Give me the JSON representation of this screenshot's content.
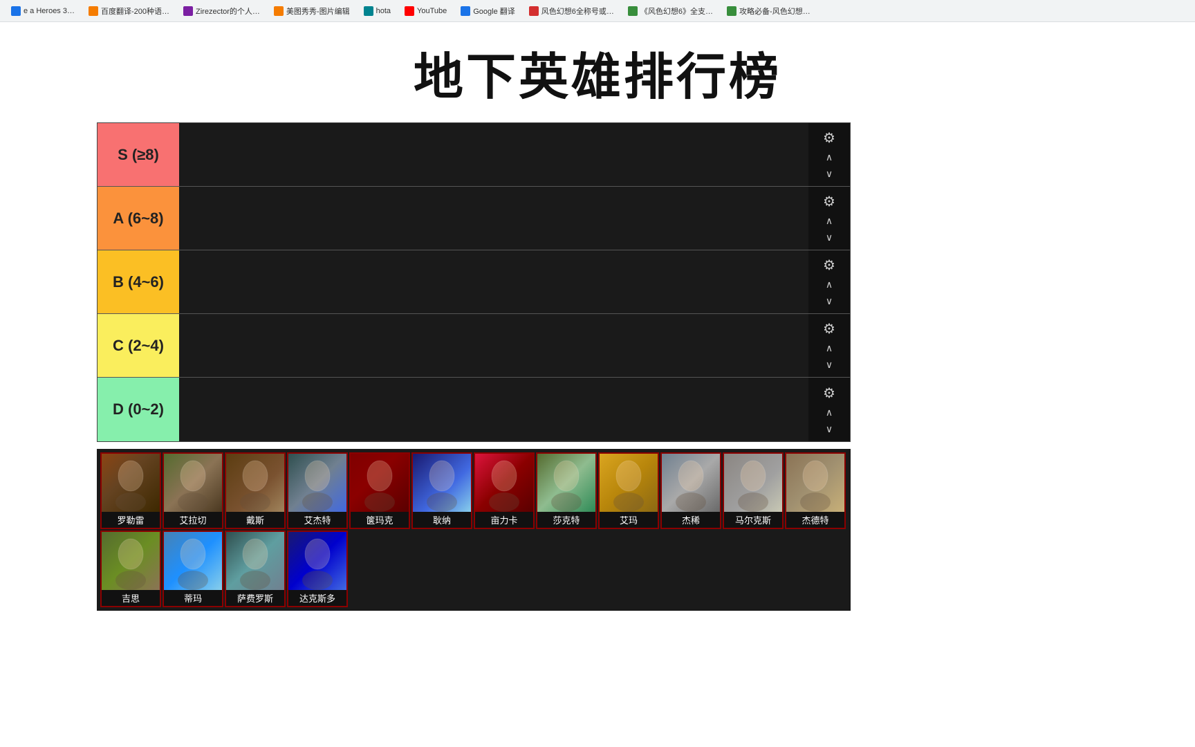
{
  "page": {
    "title": "地下英雄排行榜"
  },
  "bookmarks": [
    {
      "id": "bk1",
      "label": "e a Heroes 3…",
      "color": "bk-blue"
    },
    {
      "id": "bk2",
      "label": "百度翻译-200种语…",
      "color": "bk-orange"
    },
    {
      "id": "bk3",
      "label": "Zirezector的个人…",
      "color": "bk-purple"
    },
    {
      "id": "bk4",
      "label": "美图秀秀-图片编辑",
      "color": "bk-orange"
    },
    {
      "id": "bk5",
      "label": "hota",
      "color": "bk-teal"
    },
    {
      "id": "bk6",
      "label": "YouTube",
      "color": "bk-youtube"
    },
    {
      "id": "bk7",
      "label": "Google 翻译",
      "color": "bk-blue"
    },
    {
      "id": "bk8",
      "label": "风色幻想6全称号或…",
      "color": "bk-red"
    },
    {
      "id": "bk9",
      "label": "《风色幻想6》全支…",
      "color": "bk-green"
    },
    {
      "id": "bk10",
      "label": "攻略必备-风色幻想…",
      "color": "bk-green"
    }
  ],
  "tiers": [
    {
      "id": "s",
      "label": "S  (≥8)",
      "colorClass": "tier-s"
    },
    {
      "id": "a",
      "label": "A  (6~8)",
      "colorClass": "tier-a"
    },
    {
      "id": "b",
      "label": "B  (4~6)",
      "colorClass": "tier-b"
    },
    {
      "id": "c",
      "label": "C  (2~4)",
      "colorClass": "tier-c"
    },
    {
      "id": "d",
      "label": "D  (0~2)",
      "colorClass": "tier-d"
    }
  ],
  "heroes": [
    {
      "id": "luodun",
      "name": "罗勒雷",
      "portraitClass": "p-luodun",
      "row": 1
    },
    {
      "id": "ailaqi",
      "name": "艾拉切",
      "portraitClass": "p-ailaqi",
      "row": 1
    },
    {
      "id": "daisi",
      "name": "戴斯",
      "portraitClass": "p-daisi",
      "row": 1
    },
    {
      "id": "aijete",
      "name": "艾杰特",
      "portraitClass": "p-aijete",
      "row": 1
    },
    {
      "id": "jiemake",
      "name": "箧玛克",
      "portraitClass": "p-jiemake",
      "row": 1
    },
    {
      "id": "hengnuo",
      "name": "耿纳",
      "portraitClass": "p-hengnuo",
      "row": 1
    },
    {
      "id": "milika",
      "name": "亩力卡",
      "portraitClass": "p-milika",
      "row": 1
    },
    {
      "id": "shaokete",
      "name": "莎克特",
      "portraitClass": "p-shaokete",
      "row": 1
    },
    {
      "id": "ayuma",
      "name": "艾玛",
      "portraitClass": "p-ayuma",
      "row": 1
    },
    {
      "id": "jiexi",
      "name": "杰稀",
      "portraitClass": "p-jiexi",
      "row": 1
    },
    {
      "id": "maerkesi",
      "name": "马尔克斯",
      "portraitClass": "p-maerkesi",
      "row": 1
    },
    {
      "id": "jiedete",
      "name": "杰德特",
      "portraitClass": "p-jiedete",
      "row": 1
    },
    {
      "id": "jisi",
      "name": "吉思",
      "portraitClass": "p-jisi",
      "row": 2
    },
    {
      "id": "tima",
      "name": "蒂玛",
      "portraitClass": "p-tima",
      "row": 2
    },
    {
      "id": "safeirosi",
      "name": "萨费罗斯",
      "portraitClass": "p-safeirosi",
      "row": 2
    },
    {
      "id": "dakesiduō",
      "name": "达克斯多",
      "portraitClass": "p-dakesiduō",
      "row": 2
    }
  ],
  "icons": {
    "gear": "⚙",
    "arrowUp": "∧",
    "arrowDown": "∨"
  }
}
